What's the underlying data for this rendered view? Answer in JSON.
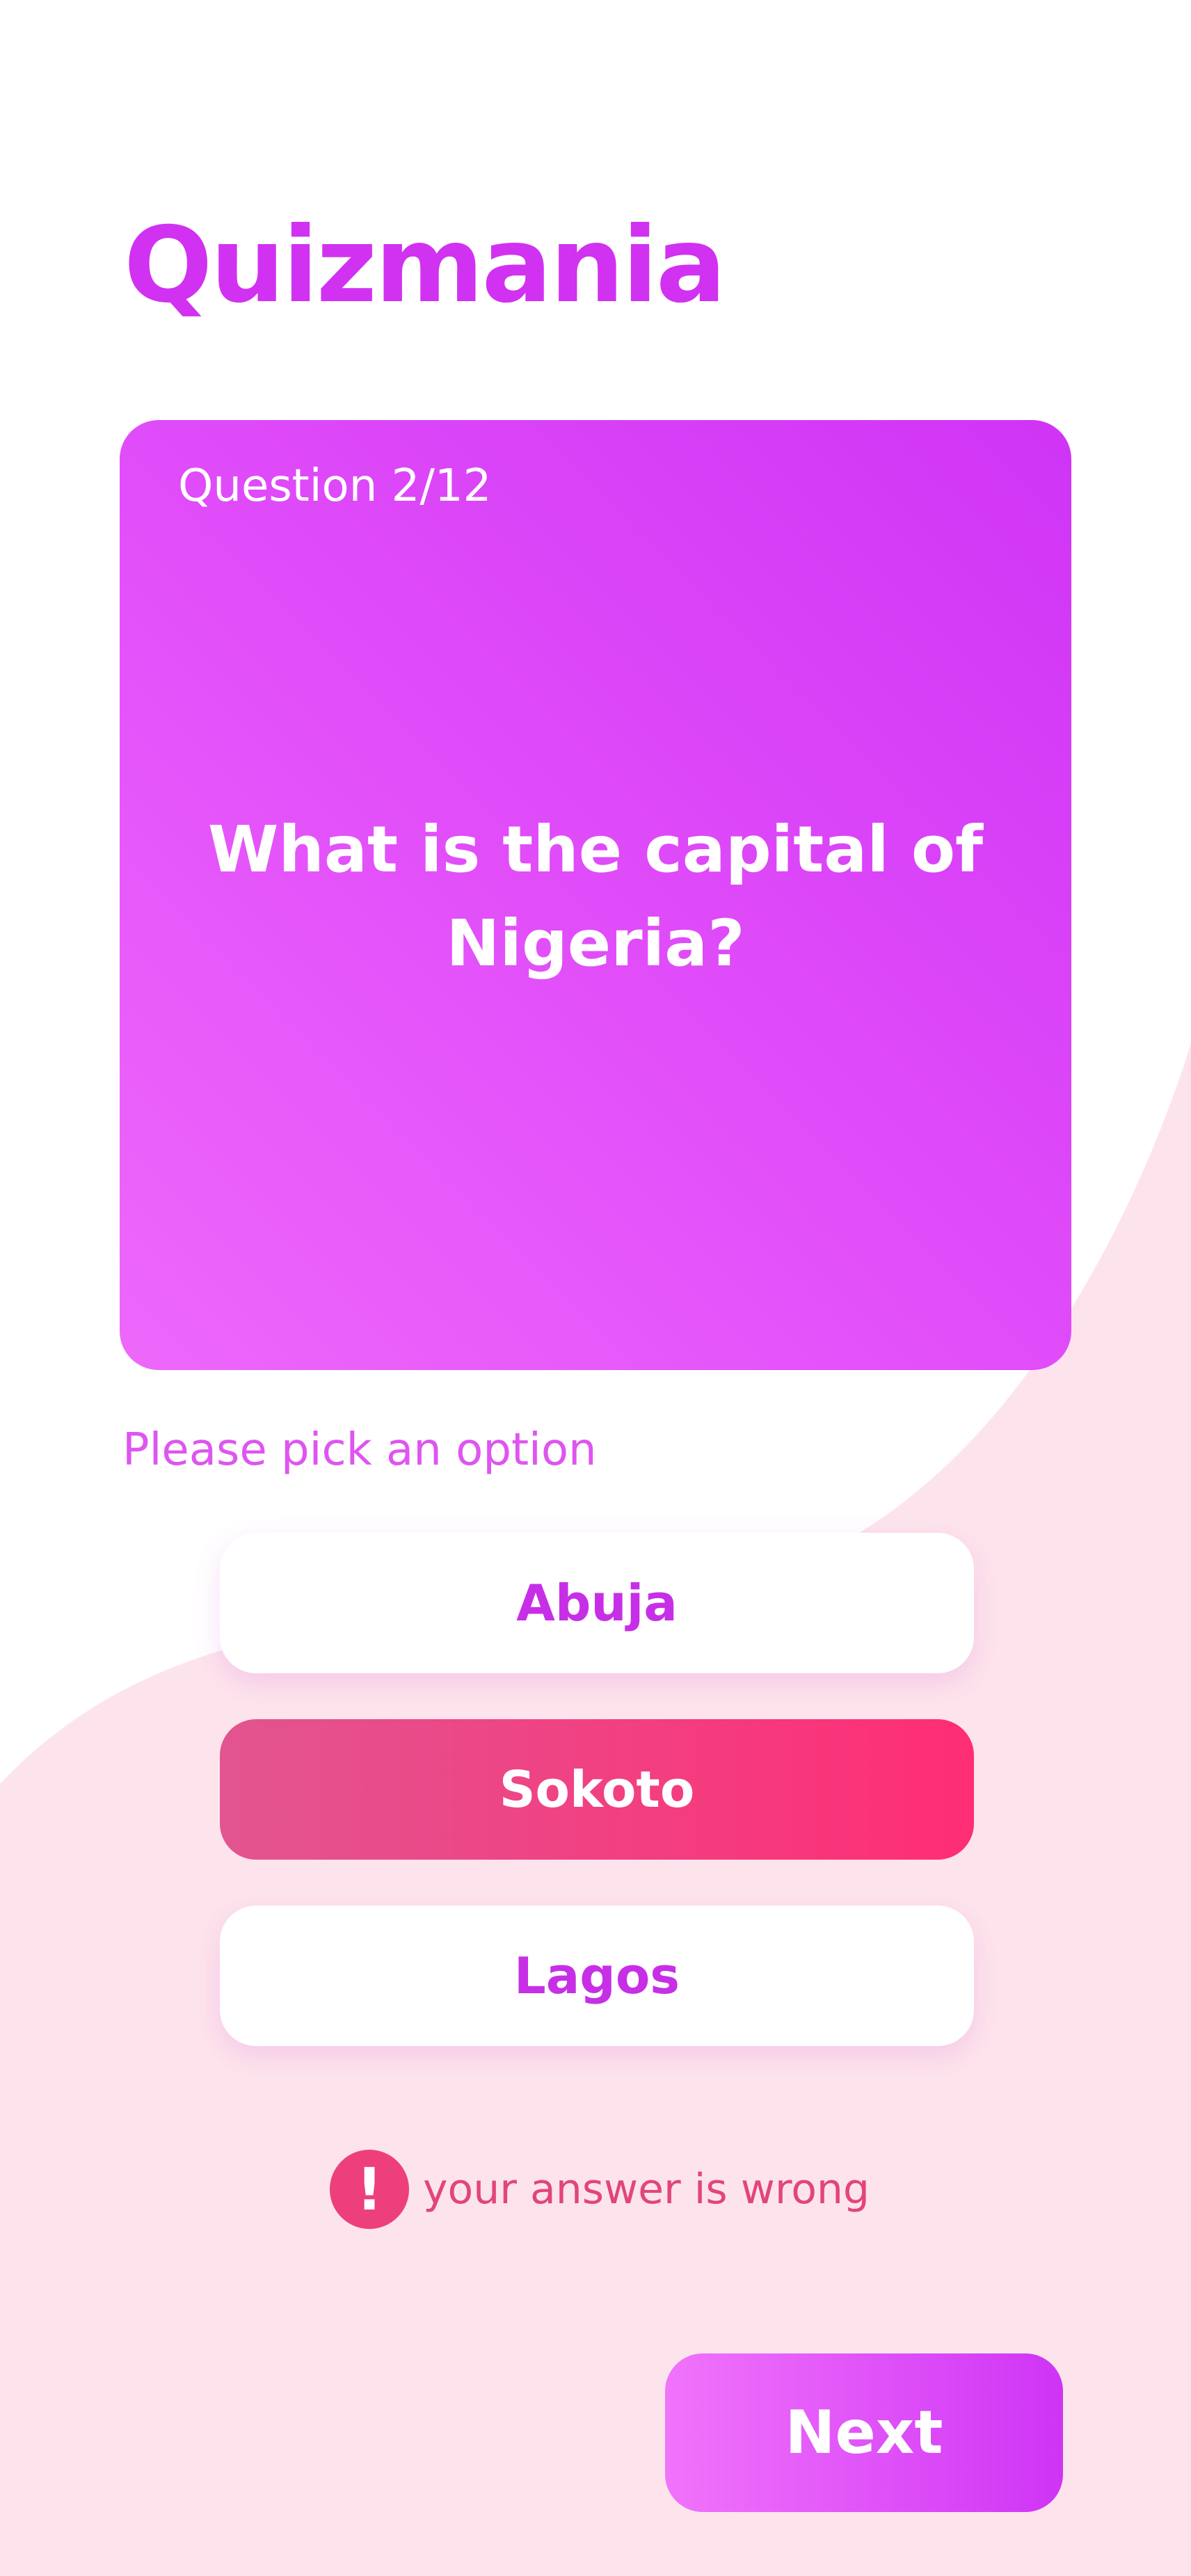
{
  "app": {
    "title": "Quizmania"
  },
  "question": {
    "counter": "Question 2/12",
    "text": "What is the capital of Nigeria?"
  },
  "hint": "Please pick an option",
  "options": [
    {
      "label": "Abuja",
      "state": "normal"
    },
    {
      "label": "Sokoto",
      "state": "selected-wrong"
    },
    {
      "label": "Lagos",
      "state": "normal"
    }
  ],
  "feedback": {
    "icon": "alert-icon",
    "text": "your answer is wrong"
  },
  "next_button": {
    "label": "Next"
  },
  "colors": {
    "accent": "#d131f0",
    "card_gradient_start": "#cf34f5",
    "card_gradient_end": "#ee68fb",
    "wrong_gradient_start": "#e25590",
    "wrong_gradient_end": "#ff2d75",
    "background_pink": "#fde4ec",
    "error": "#e2457c"
  }
}
